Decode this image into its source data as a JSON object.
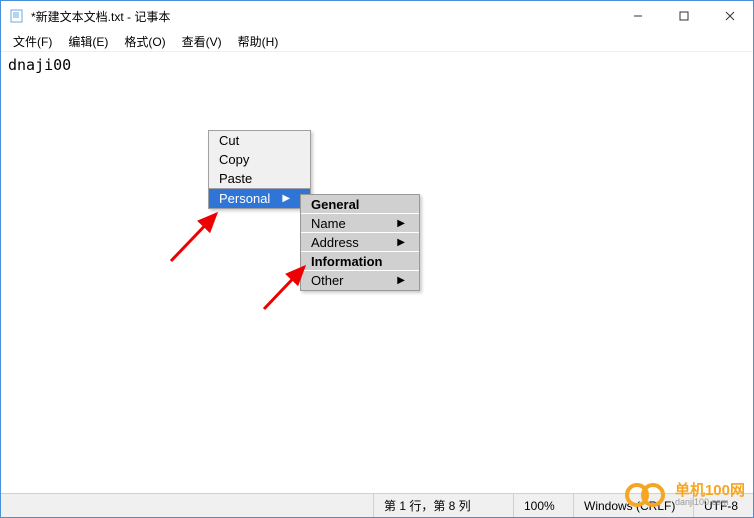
{
  "titlebar": {
    "title": "*新建文本文档.txt - 记事本"
  },
  "menu": {
    "file": "文件(F)",
    "edit": "编辑(E)",
    "format": "格式(O)",
    "view": "查看(V)",
    "help": "帮助(H)"
  },
  "content": {
    "text": "dnaji00"
  },
  "context": {
    "cut": "Cut",
    "copy": "Copy",
    "paste": "Paste",
    "personal": "Personal"
  },
  "submenu": {
    "general": "General",
    "name": "Name",
    "address": "Address",
    "information": "Information",
    "other": "Other"
  },
  "status": {
    "position": "第 1 行，第 8 列",
    "zoom": "100%",
    "eol": "Windows (CRLF)",
    "encoding": "UTF-8"
  },
  "watermark": {
    "name": "单机100网",
    "url": "danji100.com"
  }
}
